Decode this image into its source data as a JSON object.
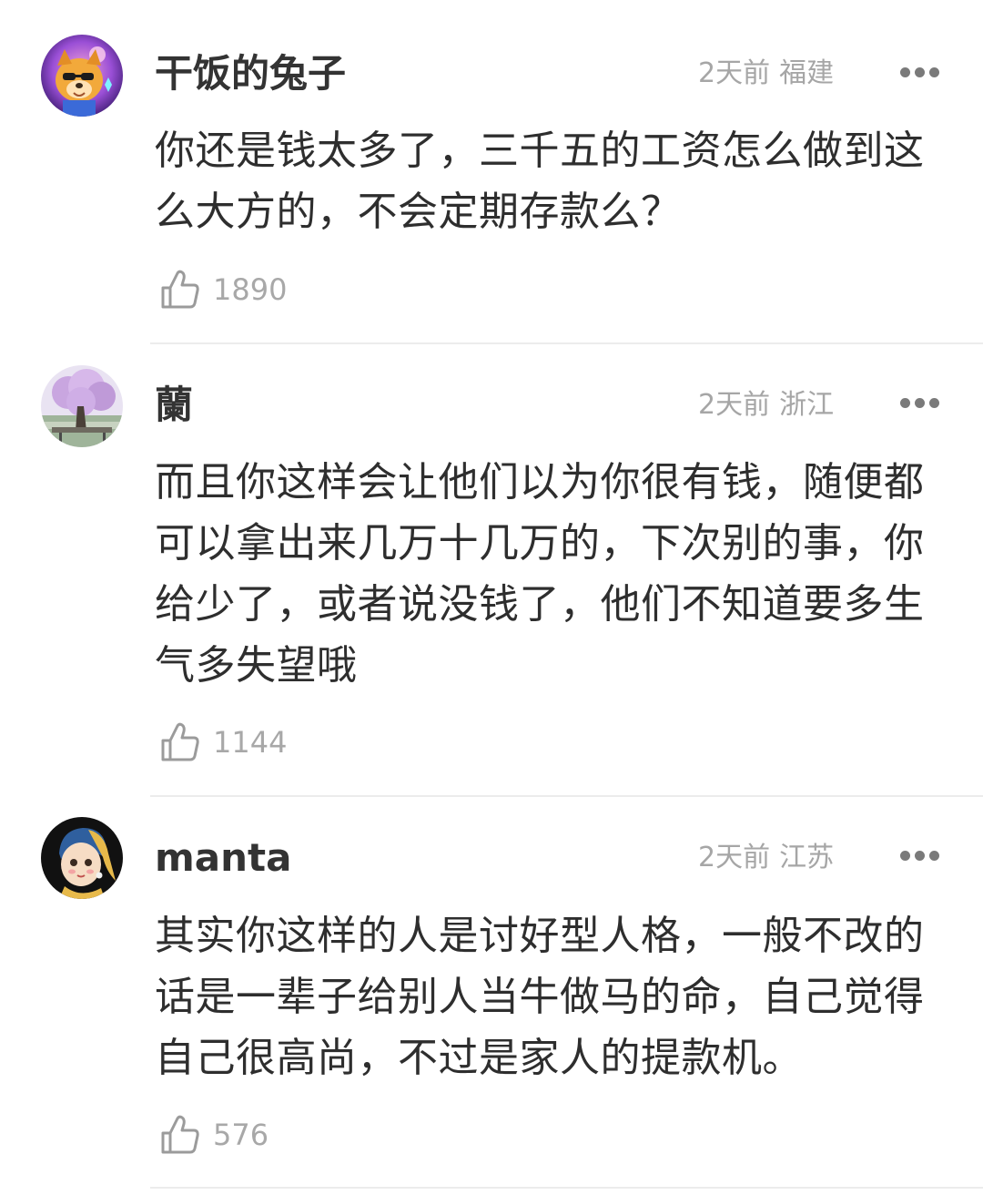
{
  "comments": [
    {
      "username": "干饭的兔子",
      "time": "2天前",
      "location": "福建",
      "text": "你还是钱太多了，三千五的工资怎么做到这么大方的，不会定期存款么？",
      "likes": "1890",
      "avatar_icon": "cartoon-dog-avatar"
    },
    {
      "username": "蘭",
      "time": "2天前",
      "location": "浙江",
      "text": "而且你这样会让他们以为你很有钱，随便都可以拿出来几万十几万的，下次别的事，你给少了，或者说没钱了，他们不知道要多生气多失望哦",
      "likes": "1144",
      "avatar_icon": "blossom-tree-avatar"
    },
    {
      "username": "manta",
      "time": "2天前",
      "location": "江苏",
      "text": "其实你这样的人是讨好型人格，一般不改的话是一辈子给别人当牛做马的命，自己觉得自己很高尚，不过是家人的提款机。",
      "likes": "576",
      "avatar_icon": "pearl-earring-girl-avatar"
    }
  ],
  "colors": {
    "username": "#333333",
    "meta": "#a6a6a6",
    "body_text": "#2e2e2e",
    "like_count": "#a8a8a8",
    "divider": "#ececec"
  }
}
